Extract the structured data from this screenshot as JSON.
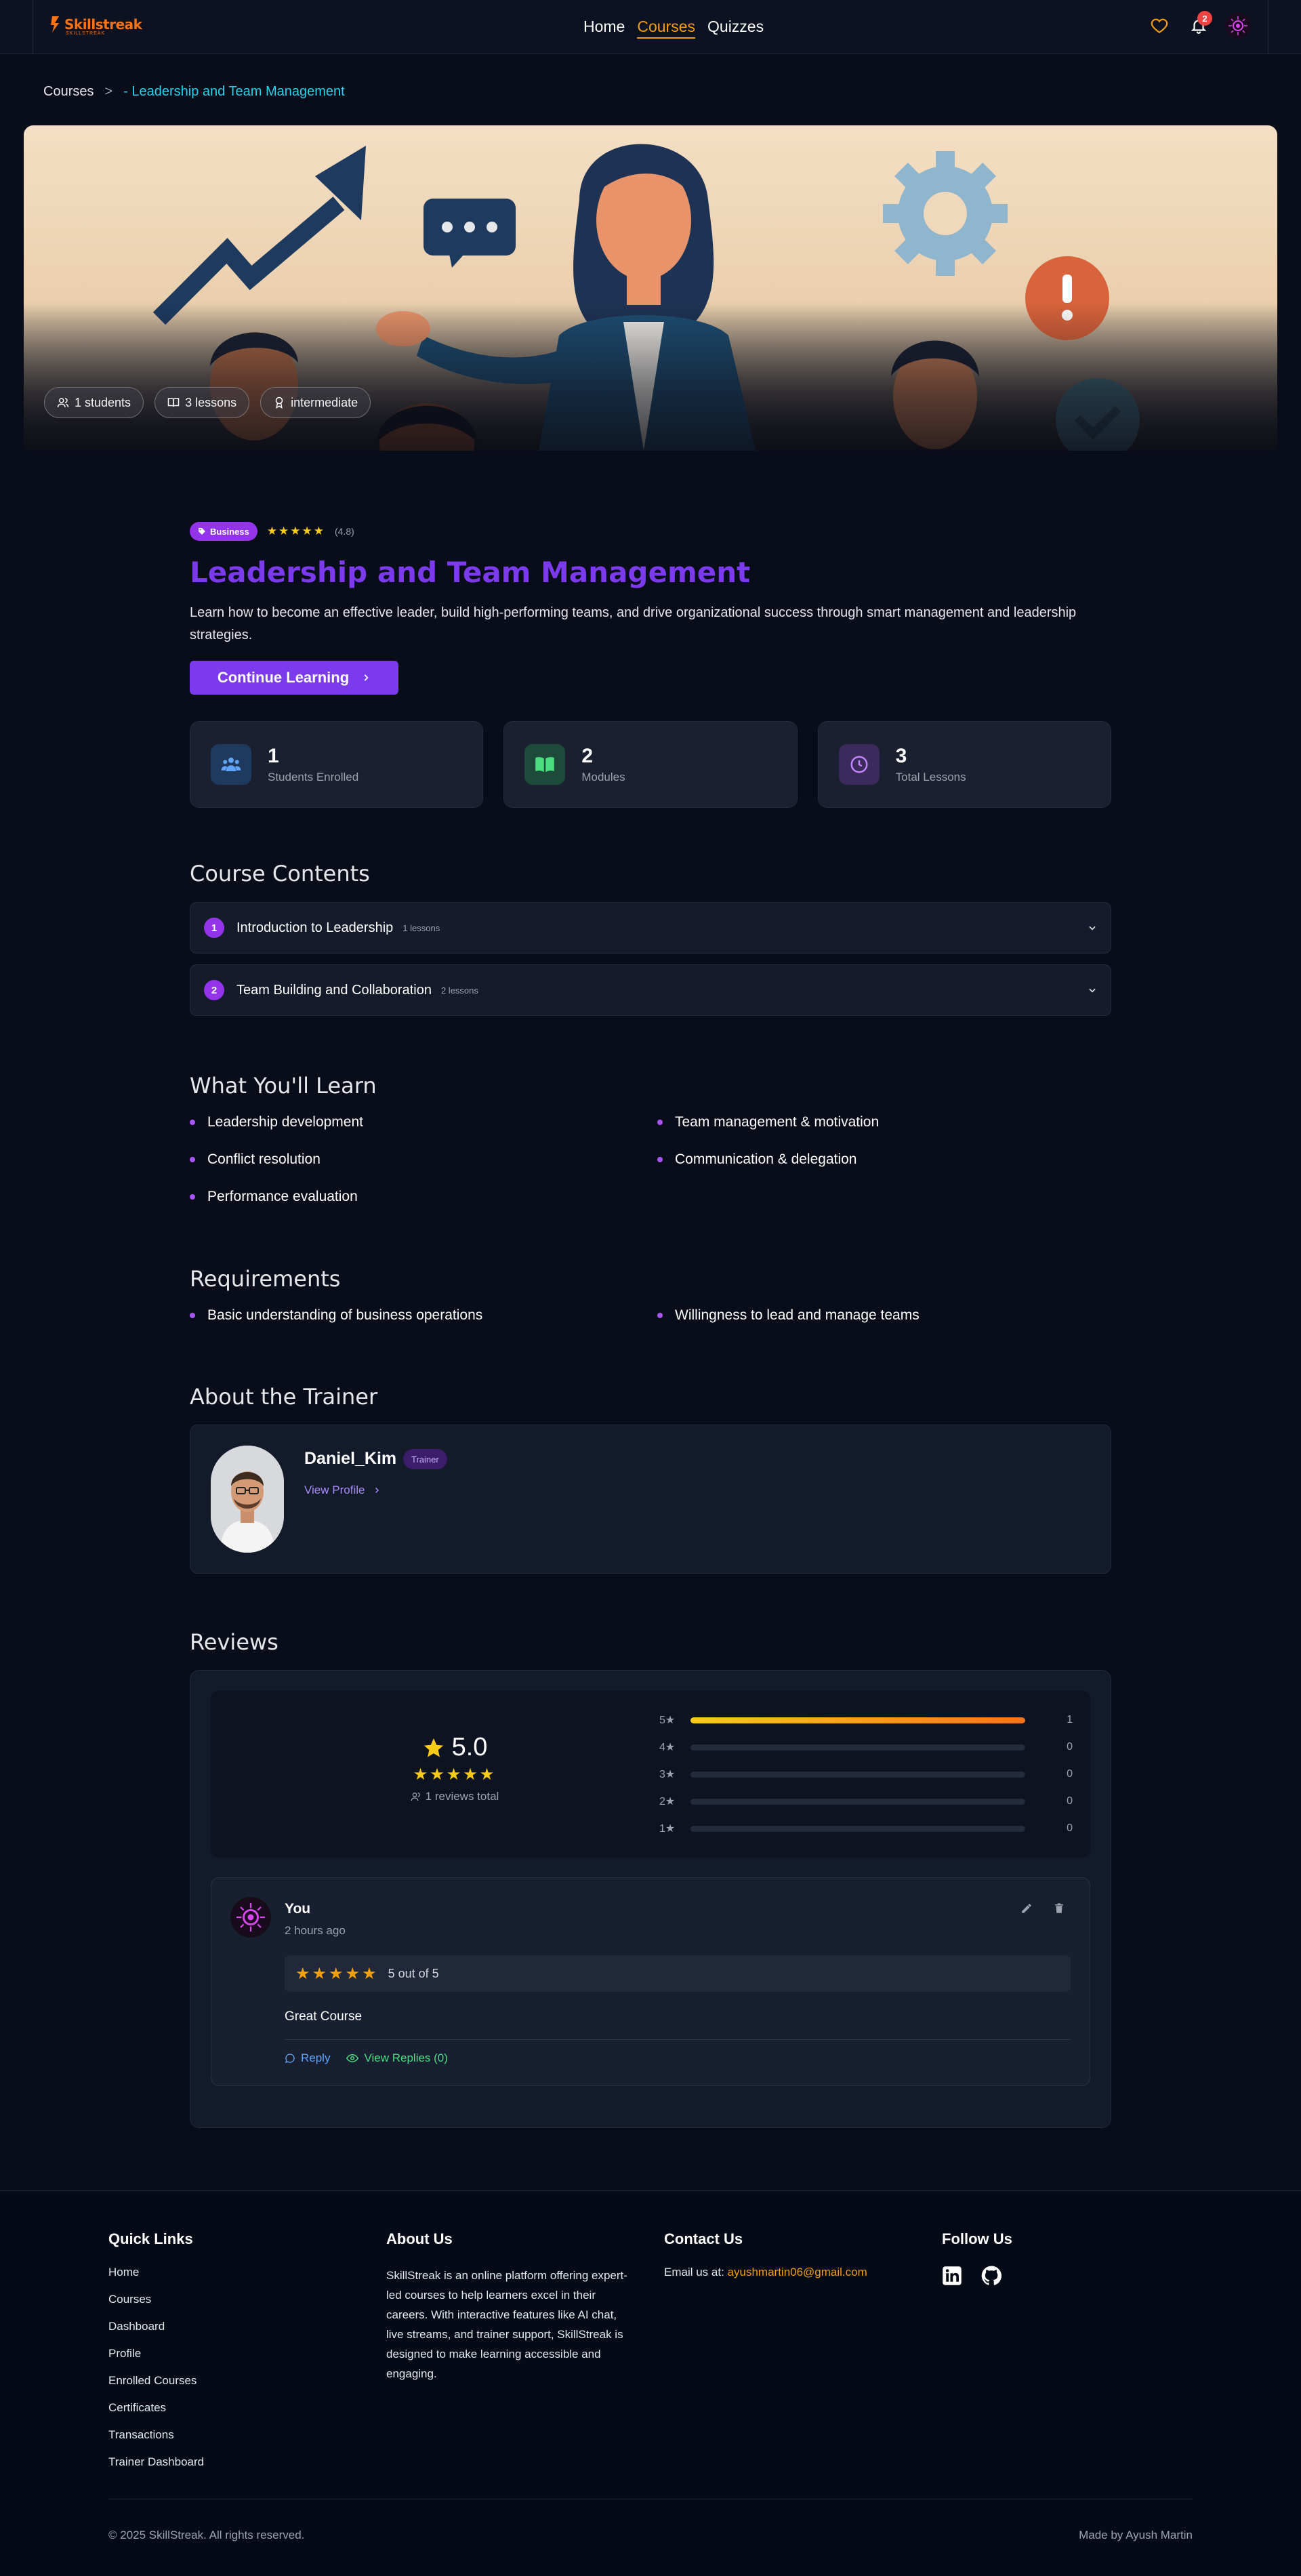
{
  "brand": {
    "name": "Skillstreak",
    "tagline": "SKILLSTREAK",
    "accent": "#f97316"
  },
  "nav": {
    "links": [
      {
        "label": "Home",
        "active": false
      },
      {
        "label": "Courses",
        "active": true
      },
      {
        "label": "Quizzes",
        "active": false
      }
    ],
    "notification_count": "2",
    "icons": [
      "heart-icon",
      "bell-icon",
      "avatar"
    ]
  },
  "breadcrumb": {
    "root": "Courses",
    "separator": ">",
    "current": "- Leadership and Team Management"
  },
  "hero": {
    "chips": [
      {
        "icon": "users-icon",
        "label": "1 students"
      },
      {
        "icon": "book-icon",
        "label": "3 lessons"
      },
      {
        "icon": "award-icon",
        "label": "intermediate"
      }
    ]
  },
  "course": {
    "category": "Business",
    "rating_stars": "★★★★★",
    "rating_text": "(4.8)",
    "title": "Leadership and Team Management",
    "description": "Learn how to become an effective leader, build high-performing teams, and drive organizational success through smart management and leadership strategies.",
    "cta": "Continue Learning"
  },
  "stats": [
    {
      "icon": "users-icon",
      "value": "1",
      "label": "Students Enrolled",
      "color": "#3b82f6"
    },
    {
      "icon": "book-open-icon",
      "value": "2",
      "label": "Modules",
      "color": "#22c55e"
    },
    {
      "icon": "clock-icon",
      "value": "3",
      "label": "Total Lessons",
      "color": "#a855f7"
    }
  ],
  "contents": {
    "title": "Course Contents",
    "modules": [
      {
        "num": "1",
        "title": "Introduction to Leadership",
        "count": "1 lessons"
      },
      {
        "num": "2",
        "title": "Team Building and Collaboration",
        "count": "2 lessons"
      }
    ]
  },
  "learn": {
    "title": "What You'll Learn",
    "items": [
      "Leadership development",
      "Team management & motivation",
      "Conflict resolution",
      "Communication & delegation",
      "Performance evaluation"
    ]
  },
  "requirements": {
    "title": "Requirements",
    "items": [
      "Basic understanding of business operations",
      "Willingness to lead and manage teams"
    ]
  },
  "trainer": {
    "section_title": "About the Trainer",
    "name": "Daniel_Kim",
    "badge": "Trainer",
    "link": "View Profile"
  },
  "reviews": {
    "title": "Reviews",
    "average": "5.0",
    "average_stars": "★★★★★",
    "total": "1 reviews total",
    "distribution": [
      {
        "label": "5★",
        "count": "1",
        "fraction": 1.0
      },
      {
        "label": "4★",
        "count": "0",
        "fraction": 0
      },
      {
        "label": "3★",
        "count": "0",
        "fraction": 0
      },
      {
        "label": "2★",
        "count": "0",
        "fraction": 0
      },
      {
        "label": "1★",
        "count": "0",
        "fraction": 0
      }
    ],
    "items": [
      {
        "author": "You",
        "time": "2 hours ago",
        "stars": "★★★★★",
        "out_of": "5 out of 5",
        "comment": "Great Course",
        "reply": "Reply",
        "view_replies": "View Replies (0)"
      }
    ]
  },
  "footer": {
    "quick_links_title": "Quick Links",
    "quick_links": [
      "Home",
      "Courses",
      "Dashboard",
      "Profile",
      "Enrolled Courses",
      "Certificates",
      "Transactions",
      "Trainer Dashboard"
    ],
    "about_title": "About Us",
    "about_text": "SkillStreak is an online platform offering expert-led courses to help learners excel in their careers. With interactive features like AI chat, live streams, and trainer support, SkillStreak is designed to make learning accessible and engaging.",
    "contact_title": "Contact Us",
    "email_label": "Email us at:",
    "email": "ayushmartin06@gmail.com",
    "follow_title": "Follow Us",
    "social": [
      "linkedin-icon",
      "github-icon"
    ],
    "copyright": "© 2025 SkillStreak. All rights reserved.",
    "made_by": "Made by Ayush Martin"
  }
}
